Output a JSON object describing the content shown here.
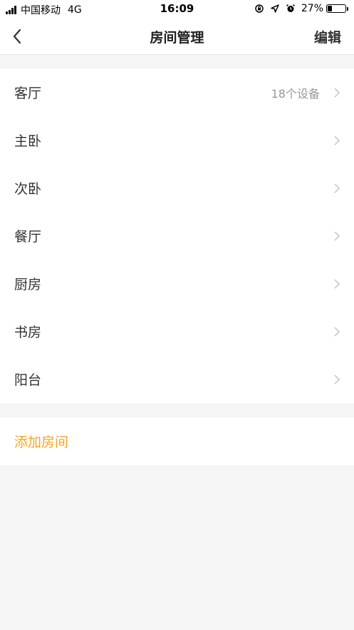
{
  "status_bar": {
    "carrier": "中国移动",
    "network": "4G",
    "time": "16:09",
    "battery": "27%",
    "battery_level": 0.27
  },
  "nav": {
    "title": "房间管理",
    "edit_label": "编辑",
    "back_icon": "chevron-left-icon"
  },
  "rooms": [
    {
      "name": "客厅",
      "device_count": "18个设备"
    },
    {
      "name": "主卧",
      "device_count": ""
    },
    {
      "name": "次卧",
      "device_count": ""
    },
    {
      "name": "餐厅",
      "device_count": ""
    },
    {
      "name": "厨房",
      "device_count": ""
    },
    {
      "name": "书房",
      "device_count": ""
    },
    {
      "name": "阳台",
      "device_count": ""
    }
  ],
  "add_room_label": "添加房间",
  "colors": {
    "accent": "#f5a623",
    "background": "#f5f5f5",
    "muted_text": "#999999"
  }
}
